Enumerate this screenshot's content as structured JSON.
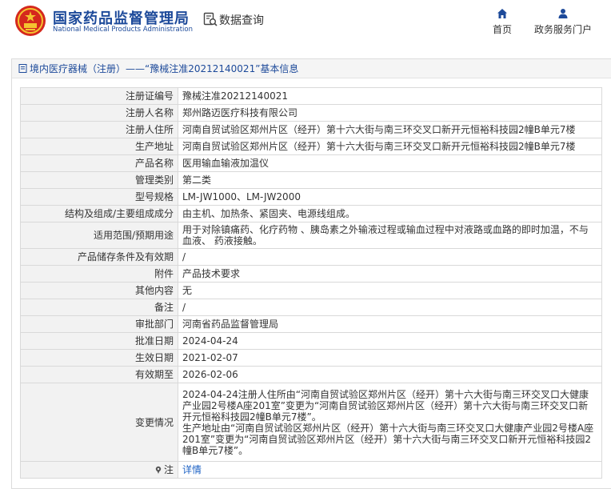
{
  "header": {
    "brand_cn": "国家药品监督管理局",
    "brand_en": "National Medical Products Administration",
    "query_label": "数据查询",
    "nav": {
      "home_label": "首页",
      "portal_label": "政务服务门户"
    }
  },
  "colors": {
    "brand_blue": "#1d4a9a",
    "link_blue": "#1d62c4",
    "label_bg": "#f2f2f2",
    "emblem_red": "#d5281d",
    "emblem_gold": "#f4c430"
  },
  "icons": {
    "emblem": "national-emblem-icon",
    "query": "data-query-icon",
    "home": "home-icon",
    "portal": "user-icon",
    "title": "document-icon",
    "note": "pin-icon"
  },
  "panel": {
    "title": "境内医疗器械（注册）——“豫械注准20212140021”基本信息"
  },
  "rows": [
    {
      "label": "注册证编号",
      "value": "豫械注准20212140021"
    },
    {
      "label": "注册人名称",
      "value": "郑州路迈医疗科技有限公司"
    },
    {
      "label": "注册人住所",
      "value": "河南自贸试验区郑州片区（经开）第十六大街与南三环交叉口新开元恒裕科技园2幢B单元7楼"
    },
    {
      "label": "生产地址",
      "value": "河南自贸试验区郑州片区（经开）第十六大街与南三环交叉口新开元恒裕科技园2幢B单元7楼"
    },
    {
      "label": "产品名称",
      "value": "医用输血输液加温仪"
    },
    {
      "label": "管理类别",
      "value": "第二类"
    },
    {
      "label": "型号规格",
      "value": "LM-JW1000、LM-JW2000"
    },
    {
      "label": "结构及组成/主要组成成分",
      "value": "由主机、加热条、紧固夹、电源线组成。"
    },
    {
      "label": "适用范围/预期用途",
      "value": "用于对除镇痛药、化疗药物 、胰岛素之外输液过程或输血过程中对液路或血路的即时加温，不与血液、 药液接触。"
    },
    {
      "label": "产品储存条件及有效期",
      "value": "/"
    },
    {
      "label": "附件",
      "value": "产品技术要求"
    },
    {
      "label": "其他内容",
      "value": "无"
    },
    {
      "label": "备注",
      "value": "/"
    },
    {
      "label": "审批部门",
      "value": "河南省药品监督管理局"
    },
    {
      "label": "批准日期",
      "value": "2024-04-24"
    },
    {
      "label": "生效日期",
      "value": "2021-02-07"
    },
    {
      "label": "有效期至",
      "value": "2026-02-06"
    },
    {
      "label": "变更情况",
      "value": "2024-04-24注册人住所由“河南自贸试验区郑州片区（经开）第十六大街与南三环交叉口大健康产业园2号楼A座201室”变更为“河南自贸试验区郑州片区（经开）第十六大街与南三环交叉口新开元恒裕科技园2幢B单元7楼”。\n生产地址由“河南自贸试验区郑州片区（经开）第十六大街与南三环交叉口大健康产业园2号楼A座201室”变更为“河南自贸试验区郑州片区（经开）第十六大街与南三环交叉口新开元恒裕科技园2幢B单元7楼”。"
    },
    {
      "label": "注",
      "value": "详情"
    }
  ]
}
